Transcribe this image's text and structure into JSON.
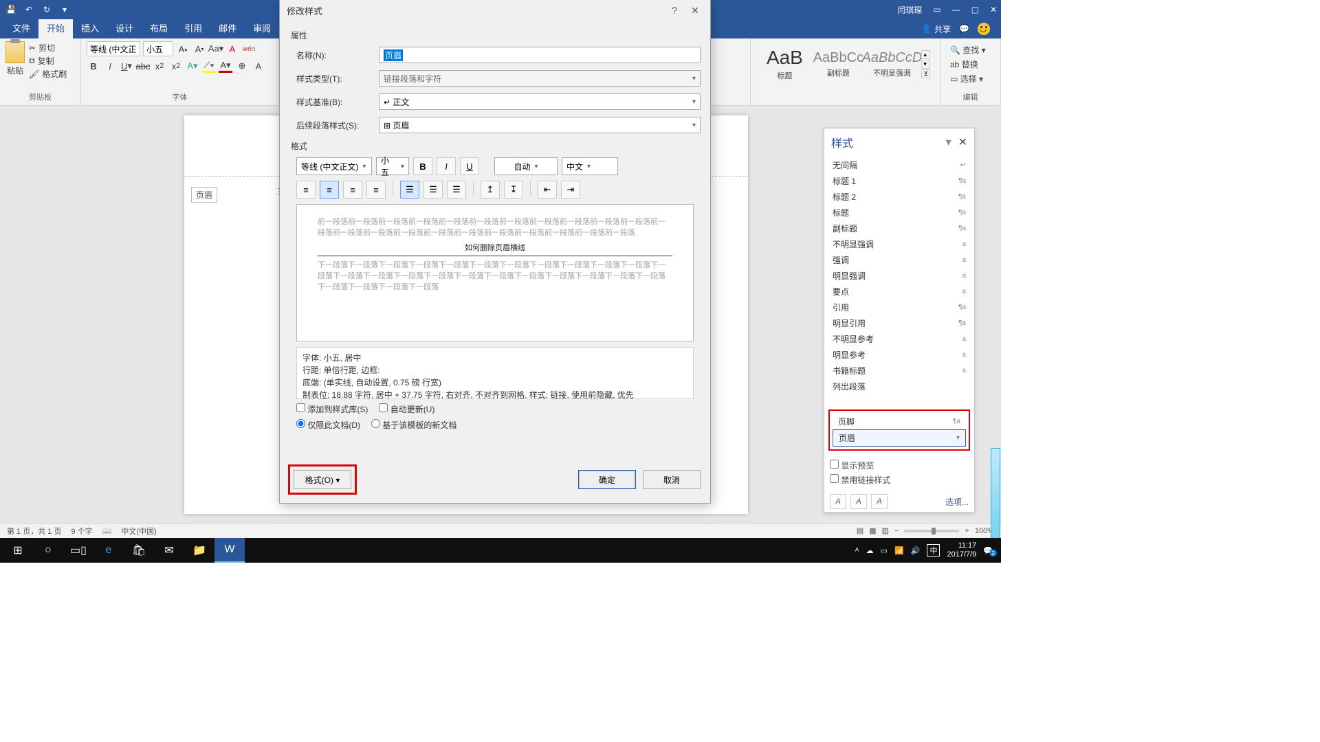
{
  "titlebar": {
    "app_user": "闫琪琛"
  },
  "tabs": {
    "file": "文件",
    "home": "开始",
    "insert": "插入",
    "design": "设计",
    "layout": "布局",
    "references": "引用",
    "mailings": "邮件",
    "review": "审阅"
  },
  "share": "共享",
  "ribbon": {
    "clipboard": {
      "paste": "粘贴",
      "cut": "剪切",
      "copy": "复制",
      "format_painter": "格式刷",
      "label": "剪贴板"
    },
    "font": {
      "name": "等线 (中文正",
      "size": "小五",
      "label": "字体"
    },
    "styles": [
      {
        "preview": "AaB",
        "label": "标题"
      },
      {
        "preview": "AaBbCc",
        "label": "副标题"
      },
      {
        "preview": "AaBbCcD",
        "label": "不明显强调"
      }
    ],
    "edit": {
      "find": "查找",
      "replace": "替换",
      "select": "选择",
      "label": "编辑"
    }
  },
  "document": {
    "header_tag": "页眉",
    "cursor_text": "如"
  },
  "dialog": {
    "title": "修改样式",
    "props_label": "属性",
    "name_label": "名称(N):",
    "name_value": "页眉",
    "type_label": "样式类型(T):",
    "type_value": "链接段落和字符",
    "based_label": "样式基准(B):",
    "based_value": "↵ 正文",
    "next_label": "后续段落样式(S):",
    "next_value": "⊞ 页眉",
    "format_label": "格式",
    "bar": {
      "font": "等线 (中文正文)",
      "size": "小五",
      "auto": "自动",
      "lang": "中文"
    },
    "preview_before": "前一段落前一段落前一段落前一段落前一段落前一段落前一段落前一段落前一段落前一段落前一段落前一段落前一段落前一段落前一段落前一段落前一段落前一段落前一段落前一段落前一段落前一段落",
    "preview_title": "如何删除页眉横线",
    "preview_after": "下一段落下一段落下一段落下一段落下一段落下一段落下一段落下一段落下一段落下一段落下一段落下一段落下一段落下一段落下一段落下一段落下一段落下一段落下一段落下一段落下一段落下一段落下一段落下一段落下一段落下一段落下一段落",
    "desc_lines": {
      "l1": "字体: 小五, 居中",
      "l2": "    行距: 单倍行距, 边框:",
      "l3": "    底端: (单实线, 自动设置,  0.75 磅 行宽)",
      "l4": "    制表位:  18.88 字符, 居中 +  37.75 字符, 右对齐, 不对齐到网格, 样式: 链接, 使用前隐藏, 优先"
    },
    "add_gallery": "添加到样式库(S)",
    "auto_update": "自动更新(U)",
    "this_doc": "仅限此文档(D)",
    "template": "基于该模板的新文档",
    "format_btn": "格式(O) ▾",
    "ok": "确定",
    "cancel": "取消"
  },
  "styles_pane": {
    "title": "样式",
    "items": [
      {
        "name": "无间隔",
        "tag": "↵"
      },
      {
        "name": "标题 1",
        "tag": "¶a"
      },
      {
        "name": "标题 2",
        "tag": "¶a"
      },
      {
        "name": "标题",
        "tag": "¶a"
      },
      {
        "name": "副标题",
        "tag": "¶a"
      },
      {
        "name": "不明显强调",
        "tag": "a"
      },
      {
        "name": "强调",
        "tag": "a"
      },
      {
        "name": "明显强调",
        "tag": "a"
      },
      {
        "name": "要点",
        "tag": "a"
      },
      {
        "name": "引用",
        "tag": "¶a"
      },
      {
        "name": "明显引用",
        "tag": "¶a"
      },
      {
        "name": "不明显参考",
        "tag": "a"
      },
      {
        "name": "明显参考",
        "tag": "a"
      },
      {
        "name": "书籍标题",
        "tag": "a"
      },
      {
        "name": "列出段落",
        "tag": ""
      },
      {
        "name": "页脚",
        "tag": "¶a"
      },
      {
        "name": "页眉",
        "tag": ""
      }
    ],
    "show_preview": "显示预览",
    "disable_linked": "禁用链接样式",
    "options": "选项..."
  },
  "statusbar": {
    "page": "第 1 页，共 1 页",
    "words": "9 个字",
    "lang": "中文(中国)",
    "zoom": "100%"
  },
  "taskbar": {
    "ime": "中",
    "time": "11:17",
    "date": "2017/7/9",
    "notif_badge": "2"
  }
}
